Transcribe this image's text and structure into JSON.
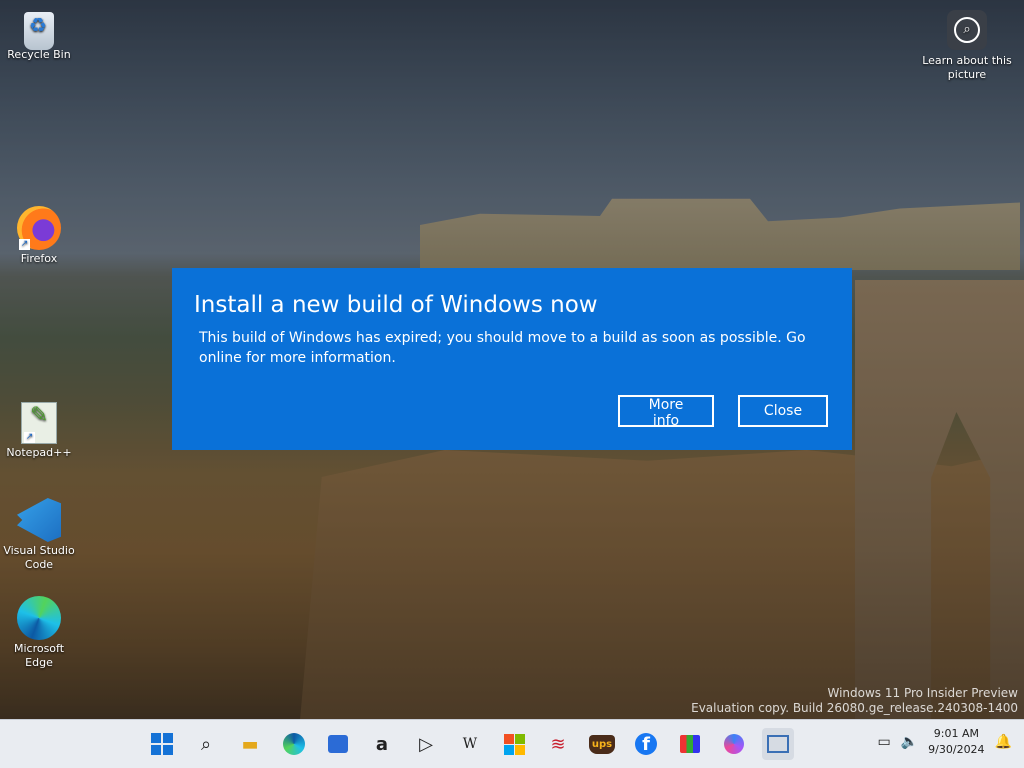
{
  "desktop": {
    "icons": [
      {
        "label": "Recycle Bin"
      },
      {
        "label": "Firefox"
      },
      {
        "label": "Notepad++"
      },
      {
        "label": "Visual Studio Code"
      },
      {
        "label": "Microsoft Edge"
      }
    ],
    "learn_label": "Learn about this picture"
  },
  "dialog": {
    "title": "Install a new build of Windows now",
    "body": "This build of Windows has expired; you should move to a build as soon as possible. Go online for more information.",
    "more_info_label": "More info",
    "close_label": "Close",
    "background_color": "#0a71d8"
  },
  "watermark": {
    "line1": "Windows 11 Pro Insider Preview",
    "line2": "Evaluation copy. Build 26080.ge_release.240308-1400"
  },
  "taskbar": {
    "apps": [
      "start",
      "search-icon",
      "file-explorer-icon",
      "edge-icon",
      "store-icon",
      "amazon-icon",
      "media-icon",
      "wikipedia-icon",
      "microsoft-icon",
      "bank-icon",
      "ups-icon",
      "facebook-icon",
      "shopping-icon",
      "copilot-icon",
      "task-view-icon"
    ],
    "wiki_label": "W",
    "ups_label": "ups",
    "facebook_label": "f",
    "amazon_label": "a",
    "time": "9:01 AM",
    "date": "9/30/2024"
  }
}
